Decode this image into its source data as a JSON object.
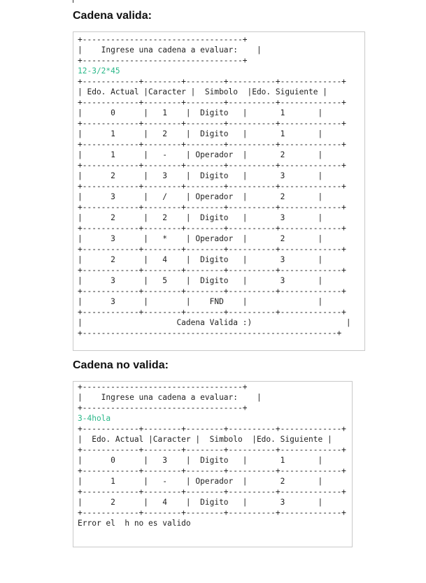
{
  "valid": {
    "heading": "Cadena valida:",
    "lines": [
      "+----------------------------------+",
      "|    Ingrese una cadena a evaluar:    |",
      "+----------------------------------+",
      "12-3/2*45",
      "+------------+--------+--------+----------+-------------+",
      "| Edo. Actual |Caracter |  Simbolo  |Edo. Siguiente |",
      "+------------+--------+--------+----------+-------------+",
      "|      0      |   1    |  Digito   |       1       |",
      "+------------+--------+--------+----------+-------------+",
      "|      1      |   2    |  Digito   |       1       |",
      "+------------+--------+--------+----------+-------------+",
      "|      1      |   -    | Operador  |       2       |",
      "+------------+--------+--------+----------+-------------+",
      "|      2      |   3    |  Digito   |       3       |",
      "+------------+--------+--------+----------+-------------+",
      "|      3      |   /    | Operador  |       2       |",
      "+------------+--------+--------+----------+-------------+",
      "|      2      |   2    |  Digito   |       3       |",
      "+------------+--------+--------+----------+-------------+",
      "|      3      |   *    | Operador  |       2       |",
      "+------------+--------+--------+----------+-------------+",
      "|      2      |   4    |  Digito   |       3       |",
      "+------------+--------+--------+----------+-------------+",
      "|      3      |   5    |  Digito   |       3       |",
      "+------------+--------+--------+----------+-------------+",
      "|      3      |        |    FND    |               |",
      "+------------+--------+--------+----------+-------------+",
      "|                    Cadena Valida :)                    |",
      "+------------------------------------------------------+"
    ]
  },
  "invalid": {
    "heading": "Cadena no valida:",
    "lines": [
      "+----------------------------------+",
      "|    Ingrese una cadena a evaluar:    |",
      "+----------------------------------+",
      "3-4hola",
      "+------------+--------+--------+----------+-------------+",
      "|  Edo. Actual |Caracter |  Simbolo  |Edo. Siguiente |",
      "+------------+--------+--------+----------+-------------+",
      "|      0      |   3    |  Digito   |       1       |",
      "+------------+--------+--------+----------+-------------+",
      "|      1      |   -    | Operador  |       2       |",
      "+------------+--------+--------+----------+-------------+",
      "|      2      |   4    |  Digito   |       3       |",
      "+------------+--------+--------+----------+-------------+",
      "Error el  h no es valido"
    ]
  },
  "colors": {
    "input": "#2cb88a",
    "border": "#c9c9c9"
  }
}
